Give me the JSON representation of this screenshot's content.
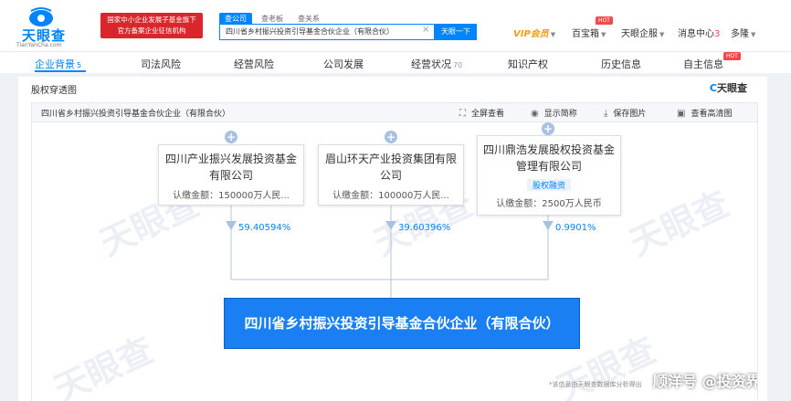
{
  "brand": {
    "logo_text": "天眼查",
    "logo_sub": "TianYanCha.com",
    "gov_line1": "国家中小企业发展子基金旗下",
    "gov_line2": "官方备案企业征信机构"
  },
  "search": {
    "tabs": [
      "查公司",
      "查老板",
      "查关系"
    ],
    "value": "四川省乡村振兴投资引导基金合伙企业（有限合伙）",
    "clear": "×",
    "button": "天眼一下"
  },
  "header_nav": {
    "vip": "VIP会员",
    "treasure": "百宝箱",
    "enterprise": "天眼企服",
    "messages": "消息中心",
    "messages_count": "3",
    "user": "多隆",
    "hot": "HOT"
  },
  "subnav": [
    {
      "label": "企业背景",
      "count": "5"
    },
    {
      "label": "司法风险",
      "count": ""
    },
    {
      "label": "经营风险",
      "count": ""
    },
    {
      "label": "公司发展",
      "count": ""
    },
    {
      "label": "经营状况",
      "count": "70"
    },
    {
      "label": "知识产权",
      "count": ""
    },
    {
      "label": "历史信息",
      "count": ""
    },
    {
      "label": "自主信息",
      "count": ""
    }
  ],
  "card": {
    "title": "股权穿透图",
    "brand_c": "C",
    "brand_rest": "天眼查",
    "toolbar_title": "四川省乡村振兴投资引导基金合伙企业（有限合伙）",
    "tools": [
      "全屏查看",
      "显示简称",
      "保存图片",
      "查看高清图"
    ],
    "tool_icons": [
      "⛶",
      "◉",
      "⤓",
      "▣"
    ]
  },
  "shareholders": [
    {
      "name": "四川产业振兴发展投资基金有限公司",
      "amount": "认缴金额：150000万人民...",
      "percent": "59.40594%",
      "tag": ""
    },
    {
      "name": "眉山环天产业投资集团有限公司",
      "amount": "认缴金额：100000万人民...",
      "percent": "39.60396%",
      "tag": ""
    },
    {
      "name": "四川鼎浩发展股权投资基金管理有限公司",
      "amount": "认缴金额：2500万人民币",
      "percent": "0.9901%",
      "tag": "股权融资"
    }
  ],
  "target": {
    "name": "四川省乡村振兴投资引导基金合伙企业（有限合伙）"
  },
  "watermark_text": "天眼查",
  "footnote": "*该信息由天眼查数据库分析得出",
  "credit": "顺洋号 @投资界",
  "colors": {
    "accent": "#0084ff",
    "target_bg": "#1a7ff2",
    "gov_red": "#d9262c",
    "vip": "#f09a1a"
  }
}
